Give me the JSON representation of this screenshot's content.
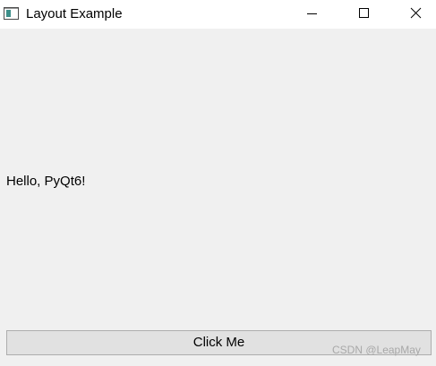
{
  "window": {
    "title": "Layout Example",
    "icon": "app-window-icon",
    "controls": {
      "minimize_icon": "minimize-icon",
      "maximize_icon": "maximize-icon",
      "close_icon": "close-icon"
    }
  },
  "main": {
    "label_text": "Hello, PyQt6!",
    "button_label": "Click Me"
  },
  "watermark": "CSDN @LeapMay",
  "colors": {
    "titlebar_bg": "#ffffff",
    "window_bg": "#f0f0f0",
    "button_bg": "#e1e1e1",
    "button_border": "#adadad"
  }
}
